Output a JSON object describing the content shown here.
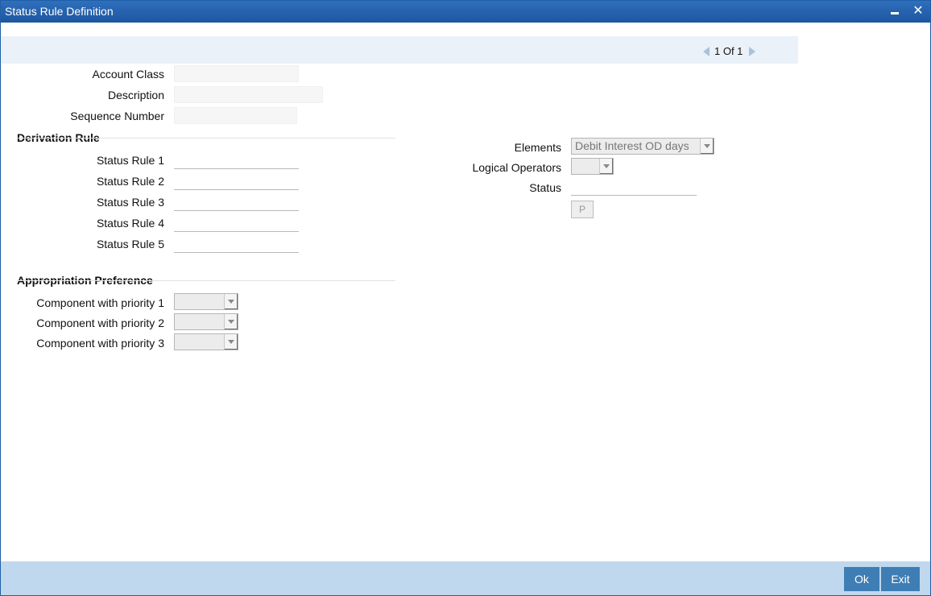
{
  "window": {
    "title": "Status Rule Definition",
    "minimize_glyph": "",
    "close_glyph": "✕"
  },
  "pager": {
    "text": "1 Of 1"
  },
  "header_fields": {
    "account_class_label": "Account Class",
    "account_class_value": "",
    "description_label": "Description",
    "description_value": "",
    "sequence_number_label": "Sequence Number",
    "sequence_number_value": ""
  },
  "derivation_rule": {
    "title": "Derivation Rule",
    "rules": [
      {
        "label": "Status Rule 1",
        "value": ""
      },
      {
        "label": "Status Rule 2",
        "value": ""
      },
      {
        "label": "Status Rule 3",
        "value": ""
      },
      {
        "label": "Status Rule 4",
        "value": ""
      },
      {
        "label": "Status Rule 5",
        "value": ""
      }
    ],
    "elements_label": "Elements",
    "elements_value": "Debit Interest OD days",
    "logical_operators_label": "Logical Operators",
    "logical_operators_value": "",
    "status_label": "Status",
    "status_value": "",
    "p_button_label": "P"
  },
  "appropriation_preference": {
    "title": "Appropriation Preference",
    "components": [
      {
        "label": "Component with priority 1",
        "value": ""
      },
      {
        "label": "Component with priority 2",
        "value": ""
      },
      {
        "label": "Component with priority 3",
        "value": ""
      }
    ]
  },
  "footer": {
    "ok_label": "Ok",
    "exit_label": "Exit"
  },
  "colors": {
    "titlebar": "#1d56a0",
    "footer": "#c0d8ee",
    "button": "#3f7db5"
  }
}
